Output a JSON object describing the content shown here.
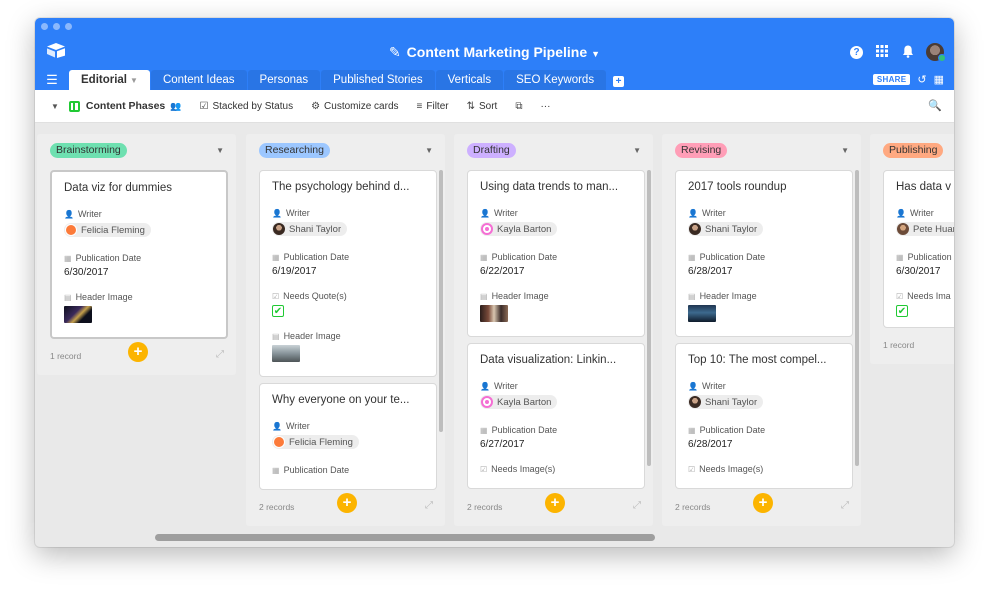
{
  "app": {
    "title": "Content Marketing Pipeline",
    "title_icon": "pencil-icon",
    "accent": "#2d7ff9"
  },
  "tabs": [
    {
      "label": "Editorial"
    },
    {
      "label": "Content Ideas"
    },
    {
      "label": "Personas"
    },
    {
      "label": "Published Stories"
    },
    {
      "label": "Verticals"
    },
    {
      "label": "SEO Keywords"
    }
  ],
  "share_label": "SHARE",
  "view": {
    "name": "Content Phases",
    "stacked_label": "Stacked by Status",
    "customize_label": "Customize cards",
    "filter_label": "Filter",
    "sort_label": "Sort",
    "more_label": "···"
  },
  "stacks": [
    {
      "status": "Brainstorming",
      "color": "#6ee0b0",
      "count_label": "1 record",
      "cards": [
        {
          "title": "Data viz for dummies",
          "writer_label": "Writer",
          "writer": "Felicia Fleming",
          "pub_label": "Publication Date",
          "pub_date": "6/30/2017",
          "image_label": "Header Image"
        }
      ]
    },
    {
      "status": "Researching",
      "color": "#9cc7ff",
      "count_label": "2 records",
      "cards": [
        {
          "title": "The psychology behind d...",
          "writer_label": "Writer",
          "writer": "Shani Taylor",
          "pub_label": "Publication Date",
          "pub_date": "6/19/2017",
          "quote_label": "Needs Quote(s)",
          "quote_checked": true,
          "image_label": "Header Image"
        },
        {
          "title": "Why everyone on your te...",
          "writer_label": "Writer",
          "writer": "Felicia Fleming",
          "pub_label": "Publication Date"
        }
      ]
    },
    {
      "status": "Drafting",
      "color": "#cdb0ff",
      "count_label": "2 records",
      "cards": [
        {
          "title": "Using data trends to man...",
          "writer_label": "Writer",
          "writer": "Kayla Barton",
          "pub_label": "Publication Date",
          "pub_date": "6/22/2017",
          "image_label": "Header Image"
        },
        {
          "title": "Data visualization: Linkin...",
          "writer_label": "Writer",
          "writer": "Kayla Barton",
          "pub_label": "Publication Date",
          "pub_date": "6/27/2017",
          "needs_label": "Needs Image(s)"
        }
      ]
    },
    {
      "status": "Revising",
      "color": "#ff9eb7",
      "count_label": "2 records",
      "cards": [
        {
          "title": "2017 tools roundup",
          "writer_label": "Writer",
          "writer": "Shani Taylor",
          "pub_label": "Publication Date",
          "pub_date": "6/28/2017",
          "image_label": "Header Image"
        },
        {
          "title": "Top 10: The most compel...",
          "writer_label": "Writer",
          "writer": "Shani Taylor",
          "pub_label": "Publication Date",
          "pub_date": "6/28/2017",
          "needs_label": "Needs Image(s)"
        }
      ]
    },
    {
      "status": "Publishing",
      "color": "#ffa981",
      "count_label": "1 record",
      "cards": [
        {
          "title": "Has data v",
          "writer_label": "Writer",
          "writer": "Pete Huar",
          "pub_label": "Publication",
          "pub_date": "6/30/2017",
          "quote_label": "Needs Ima",
          "quote_checked": true
        }
      ]
    }
  ]
}
